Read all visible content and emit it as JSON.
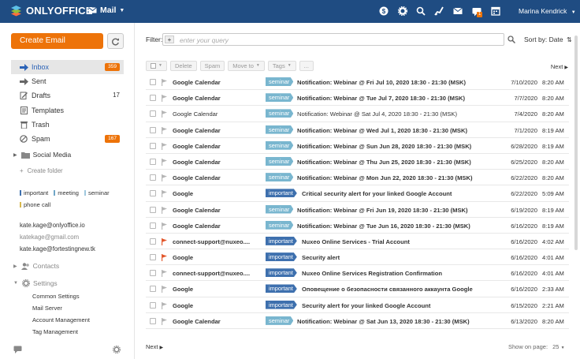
{
  "topbar": {
    "brand": "ONLYOFFICE",
    "module": "Mail",
    "notification_count": "1",
    "user": "Marina Kendrick"
  },
  "sidebar": {
    "create_label": "Create Email",
    "folders": [
      {
        "label": "Inbox",
        "badge": "359"
      },
      {
        "label": "Sent"
      },
      {
        "label": "Drafts",
        "count": "17"
      },
      {
        "label": "Templates"
      },
      {
        "label": "Trash"
      },
      {
        "label": "Spam",
        "badge": "167"
      }
    ],
    "social_media": "Social Media",
    "create_folder": "Create folder",
    "tags": [
      {
        "label": "important",
        "color": "#3e70ae"
      },
      {
        "label": "meeting",
        "color": "#6fa6c7"
      },
      {
        "label": "seminar",
        "color": "#9fc8de"
      },
      {
        "label": "phone call",
        "color": "#d8b84e"
      }
    ],
    "accounts": [
      "kate.kage@onlyoffice.io",
      "katekage@gmail.com",
      "kate.kage@fortestingnew.tk"
    ],
    "contacts": "Contacts",
    "settings": "Settings",
    "settings_items": [
      "Common Settings",
      "Mail Server",
      "Account Management",
      "Tag Management"
    ]
  },
  "main": {
    "filter_label": "Filter:",
    "filter_placeholder": "enter your query",
    "sort_label": "Sort by: Date",
    "toolbar": {
      "delete": "Delete",
      "spam": "Spam",
      "move_to": "Move to",
      "tags": "Tags",
      "more": "..."
    },
    "next_label": "Next",
    "show_on_page_label": "Show on page:",
    "page_size": "25"
  },
  "colors": {
    "important": "#3e70ae",
    "seminar": "#79b6cf",
    "accent": "#ed7309",
    "header": "#1f4c82"
  },
  "emails": [
    {
      "from": "Google Calendar",
      "tag": "seminar",
      "subject": "Notification: Webinar @ Fri Jul 10, 2020 18:30 - 21:30 (MSK)",
      "date": "7/10/2020",
      "time": "8:20 AM",
      "unread": true,
      "flag": false
    },
    {
      "from": "Google Calendar",
      "tag": "seminar",
      "subject": "Notification: Webinar @ Tue Jul 7, 2020 18:30 - 21:30 (MSK)",
      "date": "7/7/2020",
      "time": "8:20 AM",
      "unread": true,
      "flag": false
    },
    {
      "from": "Google Calendar",
      "tag": "seminar",
      "subject": "Notification: Webinar @ Sat Jul 4, 2020 18:30 - 21:30 (MSK)",
      "date": "7/4/2020",
      "time": "8:20 AM",
      "unread": false,
      "flag": false
    },
    {
      "from": "Google Calendar",
      "tag": "seminar",
      "subject": "Notification: Webinar @ Wed Jul 1, 2020 18:30 - 21:30 (MSK)",
      "date": "7/1/2020",
      "time": "8:19 AM",
      "unread": true,
      "flag": false
    },
    {
      "from": "Google Calendar",
      "tag": "seminar",
      "subject": "Notification: Webinar @ Sun Jun 28, 2020 18:30 - 21:30 (MSK)",
      "date": "6/28/2020",
      "time": "8:19 AM",
      "unread": true,
      "flag": false
    },
    {
      "from": "Google Calendar",
      "tag": "seminar",
      "subject": "Notification: Webinar @ Thu Jun 25, 2020 18:30 - 21:30 (MSK)",
      "date": "6/25/2020",
      "time": "8:20 AM",
      "unread": true,
      "flag": false
    },
    {
      "from": "Google Calendar",
      "tag": "seminar",
      "subject": "Notification: Webinar @ Mon Jun 22, 2020 18:30 - 21:30 (MSK)",
      "date": "6/22/2020",
      "time": "8:20 AM",
      "unread": true,
      "flag": false
    },
    {
      "from": "Google",
      "tag": "important",
      "subject": "Critical security alert for your linked Google Account",
      "date": "6/22/2020",
      "time": "5:09 AM",
      "unread": true,
      "flag": false
    },
    {
      "from": "Google Calendar",
      "tag": "seminar",
      "subject": "Notification: Webinar @ Fri Jun 19, 2020 18:30 - 21:30 (MSK)",
      "date": "6/19/2020",
      "time": "8:19 AM",
      "unread": true,
      "flag": false
    },
    {
      "from": "Google Calendar",
      "tag": "seminar",
      "subject": "Notification: Webinar @ Tue Jun 16, 2020 18:30 - 21:30 (MSK)",
      "date": "6/16/2020",
      "time": "8:19 AM",
      "unread": true,
      "flag": false
    },
    {
      "from": "connect-support@nuxeo....",
      "tag": "important",
      "subject": "Nuxeo Online Services - Trial Account",
      "date": "6/16/2020",
      "time": "4:02 AM",
      "unread": true,
      "flag": true
    },
    {
      "from": "Google",
      "tag": "important",
      "subject": "Security alert",
      "date": "6/16/2020",
      "time": "4:01 AM",
      "unread": true,
      "flag": true
    },
    {
      "from": "connect-support@nuxeo....",
      "tag": "important",
      "subject": "Nuxeo Online Services Registration Confirmation",
      "date": "6/16/2020",
      "time": "4:01 AM",
      "unread": true,
      "flag": false
    },
    {
      "from": "Google",
      "tag": "important",
      "subject": "Оповещение о безопасности связанного аккаунта Google",
      "date": "6/16/2020",
      "time": "2:33 AM",
      "unread": true,
      "flag": false
    },
    {
      "from": "Google",
      "tag": "important",
      "subject": "Security alert for your linked Google Account",
      "date": "6/15/2020",
      "time": "2:21 AM",
      "unread": true,
      "flag": false
    },
    {
      "from": "Google Calendar",
      "tag": "seminar",
      "subject": "Notification: Webinar @ Sat Jun 13, 2020 18:30 - 21:30 (MSK)",
      "date": "6/13/2020",
      "time": "8:20 AM",
      "unread": true,
      "flag": false
    }
  ]
}
